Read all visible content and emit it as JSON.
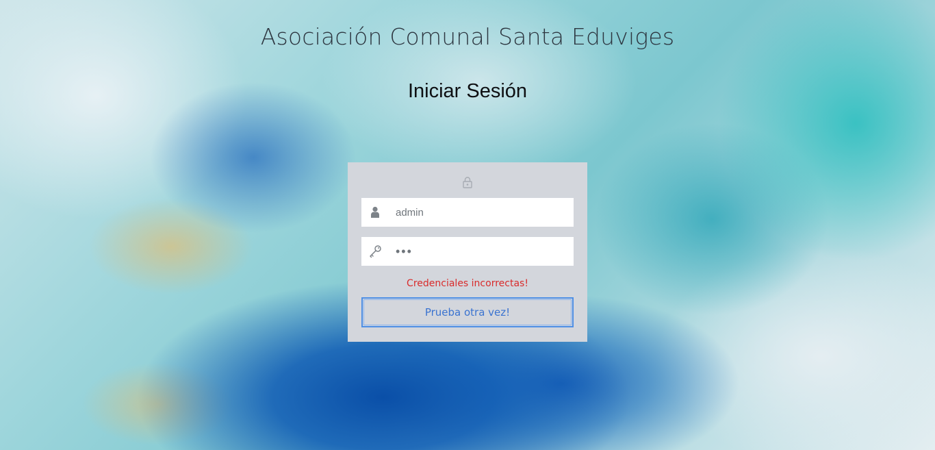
{
  "header": {
    "site_title": "Asociación Comunal Santa Eduviges",
    "page_heading": "Iniciar Sesión"
  },
  "login_form": {
    "lock_icon": "lock-icon",
    "username": {
      "icon": "user-icon",
      "value": "admin"
    },
    "password": {
      "icon": "key-icon",
      "masked_value": "•••"
    },
    "error_message": "Credenciales incorrectas!",
    "retry_button_label": "Prueba otra vez!"
  },
  "colors": {
    "card_background": "#d3d6dc",
    "error_text": "#d92b2b",
    "button_border": "#4d8fe6",
    "button_text": "#3a73d0"
  }
}
